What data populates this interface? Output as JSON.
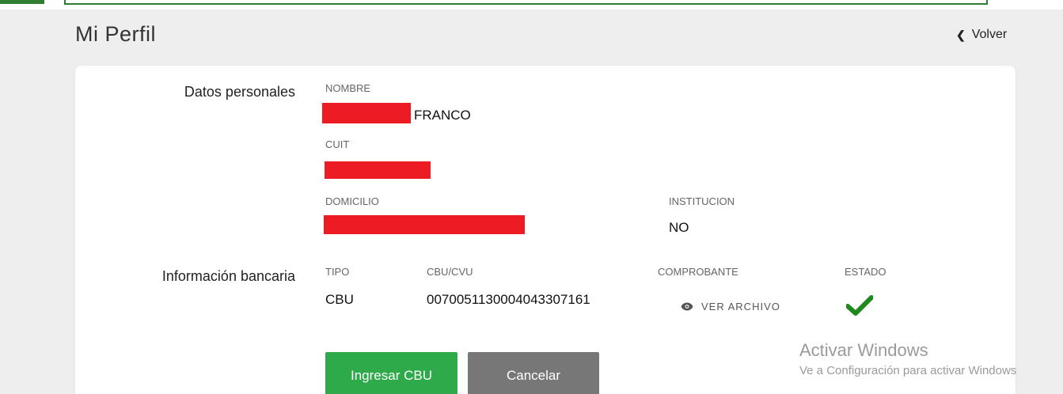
{
  "page": {
    "title": "Mi Perfil",
    "back_label": "Volver"
  },
  "personal": {
    "section_label": "Datos personales",
    "nombre_label": "NOMBRE",
    "nombre_value": "FRANCO",
    "cuit_label": "CUIT",
    "domicilio_label": "DOMICILIO",
    "institucion_label": "INSTITUCION",
    "institucion_value": "NO"
  },
  "bank": {
    "section_label": "Información bancaria",
    "tipo_label": "TIPO",
    "tipo_value": "CBU",
    "cbu_label": "CBU/CVU",
    "cbu_value": "0070051130004043307161",
    "comprobante_label": "COMPROBANTE",
    "ver_archivo_label": "VER ARCHIVO",
    "estado_label": "ESTADO"
  },
  "actions": {
    "primary_label": "Ingresar CBU",
    "secondary_label": "Cancelar"
  },
  "watermark": {
    "title": "Activar Windows",
    "subtitle": "Ve a Configuración para activar Windows"
  },
  "colors": {
    "primary_button": "#2eaa4a",
    "secondary_button": "#777777",
    "check": "#1e8a1e",
    "redaction": "#ed1c24"
  },
  "icons": {
    "back": "chevron-left-icon",
    "view": "eye-icon",
    "status": "checkmark-icon"
  }
}
